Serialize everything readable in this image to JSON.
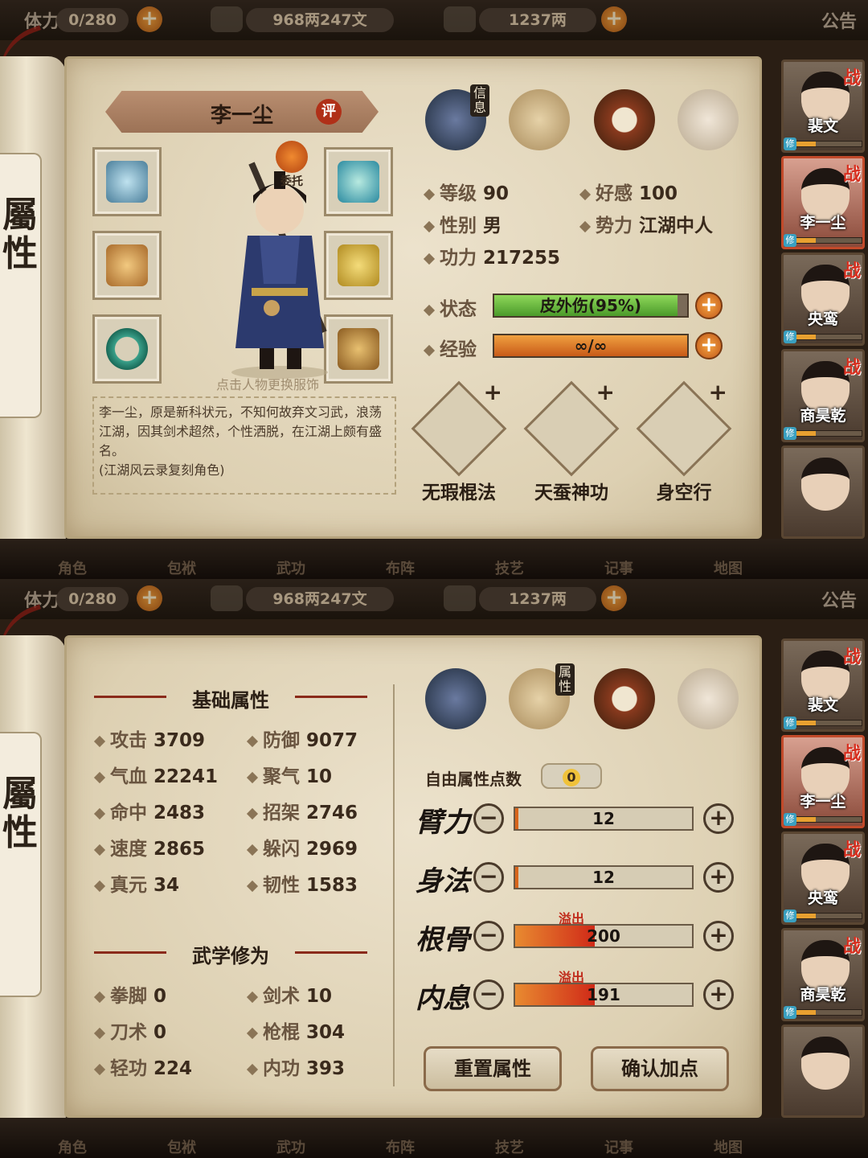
{
  "resources": {
    "stamina": "0/280",
    "stamina_prefix": "体力",
    "copper": "968两247文",
    "gold": "1237两",
    "notice": "公告"
  },
  "side_tab": "屬性",
  "nav": [
    "角色",
    "包袱",
    "武功",
    "布阵",
    "技艺",
    "记事",
    "地图"
  ],
  "heroes": [
    {
      "name": "裴文",
      "war": "战",
      "xiu": "修",
      "progress": 0.3
    },
    {
      "name": "李一尘",
      "war": "战",
      "xiu": "修",
      "progress": 0.3
    },
    {
      "name": "央鸾",
      "war": "战",
      "xiu": "修",
      "progress": 0.3
    },
    {
      "name": "商昊乾",
      "war": "战",
      "xiu": "修",
      "progress": 0.3
    },
    {
      "name": "",
      "war": "",
      "xiu": "",
      "progress": 0
    }
  ],
  "info": {
    "tab_label": "信息",
    "name": "李一尘",
    "rate": "评",
    "delegate": "委托",
    "hint": "点击人物更换服饰",
    "bio": "李一尘，原是新科状元，不知何故弃文习武，浪荡江湖，因其剑术超然，个性洒脱，在江湖上颇有盛名。\n(江湖风云录复刻角色)",
    "level_k": "等级",
    "level_v": "90",
    "favor_k": "好感",
    "favor_v": "100",
    "gender_k": "性别",
    "gender_v": "男",
    "faction_k": "势力",
    "faction_v": "江湖中人",
    "power_k": "功力",
    "power_v": "217255",
    "status_k": "状态",
    "status_v": "皮外伤(95%)",
    "status_fill": 0.95,
    "exp_k": "经验",
    "exp_v": "∞/∞",
    "exp_fill": 1,
    "skills": [
      {
        "name": "无瑕棍法",
        "plus": "+"
      },
      {
        "name": "天蚕神功",
        "plus": "+"
      },
      {
        "name": "身空行",
        "plus": "+"
      }
    ]
  },
  "attrs": {
    "tab_label": "属性",
    "base_title": "基础属性",
    "base": [
      {
        "k": "攻击",
        "v": "3709"
      },
      {
        "k": "防御",
        "v": "9077"
      },
      {
        "k": "气血",
        "v": "22241"
      },
      {
        "k": "聚气",
        "v": "10"
      },
      {
        "k": "命中",
        "v": "2483"
      },
      {
        "k": "招架",
        "v": "2746"
      },
      {
        "k": "速度",
        "v": "2865"
      },
      {
        "k": "躲闪",
        "v": "2969"
      },
      {
        "k": "真元",
        "v": "34"
      },
      {
        "k": "韧性",
        "v": "1583"
      }
    ],
    "martial_title": "武学修为",
    "martial": [
      {
        "k": "拳脚",
        "v": "0"
      },
      {
        "k": "剑术",
        "v": "10"
      },
      {
        "k": "刀术",
        "v": "0"
      },
      {
        "k": "枪棍",
        "v": "304"
      },
      {
        "k": "轻功",
        "v": "224"
      },
      {
        "k": "内功",
        "v": "393"
      }
    ],
    "free_label": "自由属性点数",
    "free_value": "0",
    "points": [
      {
        "name": "臂力",
        "value": "12",
        "fill": 0.02,
        "overflow": ""
      },
      {
        "name": "身法",
        "value": "12",
        "fill": 0.02,
        "overflow": ""
      },
      {
        "name": "根骨",
        "value": "200",
        "fill": 0.45,
        "overflow": "溢出"
      },
      {
        "name": "内息",
        "value": "191",
        "fill": 0.45,
        "overflow": "溢出"
      }
    ],
    "reset_label": "重置属性",
    "confirm_label": "确认加点"
  }
}
